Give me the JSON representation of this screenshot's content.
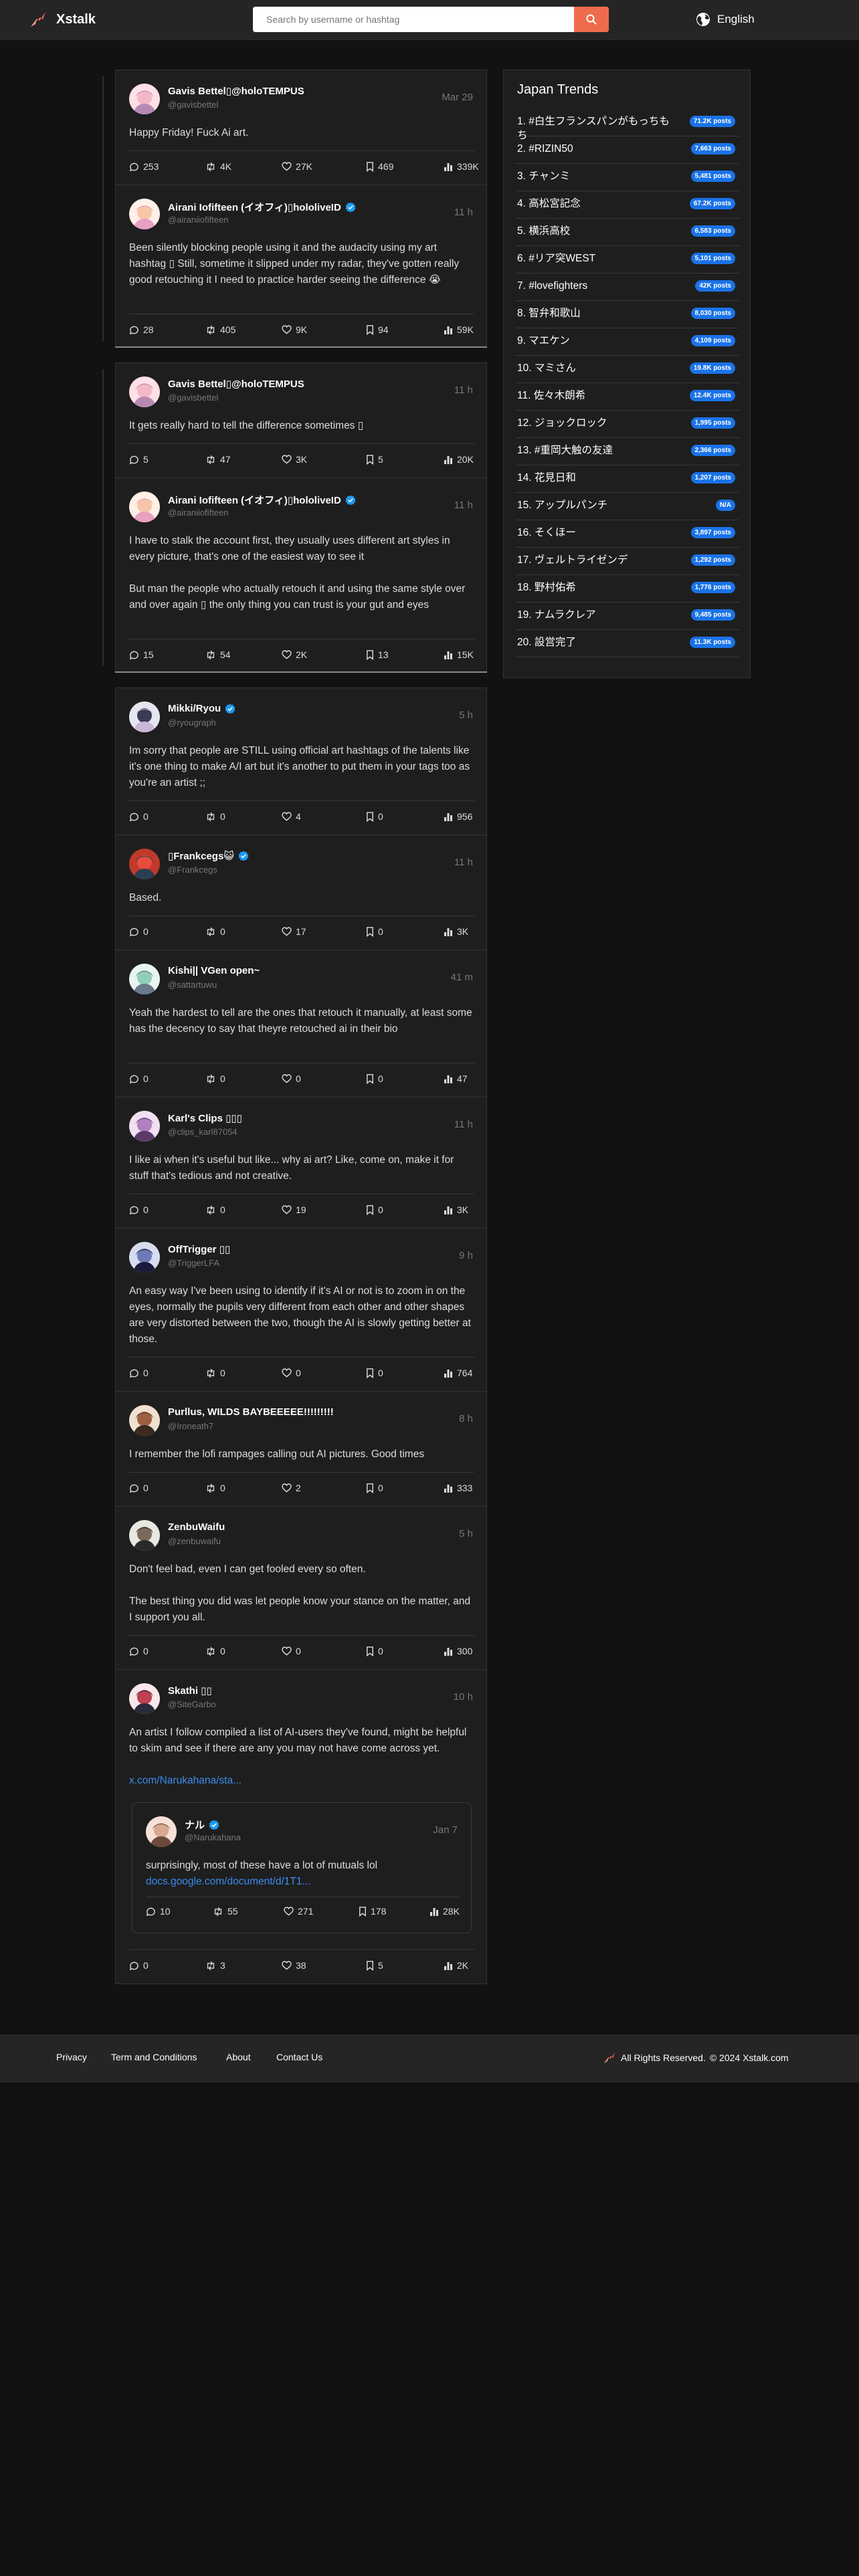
{
  "header": {
    "brand": "Xstalk",
    "search_placeholder": "Search by username or hashtag",
    "language": "English"
  },
  "threads": [
    {
      "posts": [
        {
          "name": "Gavis Bettel▯@holoTEMPUS",
          "handle": "@gavisbettel",
          "time": "Mar 29",
          "text": "Happy Friday! Fuck Ai art.",
          "stats": {
            "replies": "253",
            "reposts": "4K",
            "likes": "27K",
            "bookmarks": "469",
            "views": "339K"
          },
          "avatar": "avatar-gavis"
        },
        {
          "name": "Airani Iofifteen (イオフィ)▯hololiveID",
          "handle": "@airaniiofifteen",
          "time": "11 h",
          "verified": true,
          "text": "Been silently blocking people using it and the audacity using my art hashtag ▯ Still, sometime it slipped under my radar, they've gotten really good retouching it I need to practice harder seeing the difference 😭",
          "stats": {
            "replies": "28",
            "reposts": "405",
            "likes": "9K",
            "bookmarks": "94",
            "views": "59K"
          },
          "avatar": "avatar-iofi"
        }
      ]
    },
    {
      "posts": [
        {
          "name": "Gavis Bettel▯@holoTEMPUS",
          "handle": "@gavisbettel",
          "time": "11 h",
          "text": "It gets really hard to tell the difference sometimes ▯",
          "stats": {
            "replies": "5",
            "reposts": "47",
            "likes": "3K",
            "bookmarks": "5",
            "views": "20K"
          },
          "avatar": "avatar-gavis"
        },
        {
          "name": "Airani Iofifteen (イオフィ)▯hololiveID",
          "handle": "@airaniiofifteen",
          "time": "11 h",
          "verified": true,
          "text": "I have to stalk the account first, they usually uses different art styles in every picture, that's one of the easiest way to see it\n\nBut man the people who actually retouch it and using the same style over and over again ▯ the only thing you can trust is your gut and eyes",
          "stats": {
            "replies": "15",
            "reposts": "54",
            "likes": "2K",
            "bookmarks": "13",
            "views": "15K"
          },
          "avatar": "avatar-iofi"
        }
      ]
    }
  ],
  "replies": [
    {
      "name": "Mikki/Ryou",
      "handle": "@ryougraph",
      "time": "5 h",
      "verified": true,
      "text": "Im sorry that people are STILL using official art hashtags of the talents like it's one thing to make A/I art but it's another to put them in your tags too as you're an artist ;;",
      "stats": {
        "replies": "0",
        "reposts": "0",
        "likes": "4",
        "bookmarks": "0",
        "views": "956"
      },
      "avatar": "avatar-mikki"
    },
    {
      "name": "▯Frankcegs😺",
      "handle": "@Frankcegs",
      "time": "11 h",
      "verified": true,
      "text": "Based.",
      "stats": {
        "replies": "0",
        "reposts": "0",
        "likes": "17",
        "bookmarks": "0",
        "views": "3K"
      },
      "avatar": "avatar-frank"
    },
    {
      "name": "Kishi|| VGen open~",
      "handle": "@sattartuwu",
      "time": "41 m",
      "text": "Yeah the hardest to tell are the ones that retouch it manually, at least some has the decency to say that theyre retouched ai in their bio",
      "stats": {
        "replies": "0",
        "reposts": "0",
        "likes": "0",
        "bookmarks": "0",
        "views": "47"
      },
      "avatar": "avatar-kishi"
    },
    {
      "name": "Karl's Clips ▯▯▯",
      "handle": "@clips_karl87054",
      "time": "11 h",
      "text": "I like ai when it's useful but like... why ai art? Like, come on, make it for stuff that's tedious and not creative.",
      "stats": {
        "replies": "0",
        "reposts": "0",
        "likes": "19",
        "bookmarks": "0",
        "views": "3K"
      },
      "avatar": "avatar-karl"
    },
    {
      "name": "OffTrigger ▯▯",
      "handle": "@TriggerLFA",
      "time": "9 h",
      "text": "An easy way I've been using to identify if it's AI or not is to zoom in on the eyes, normally the pupils very different from each other and other shapes are very distorted between the two, though the AI is slowly getting better at those.",
      "stats": {
        "replies": "0",
        "reposts": "0",
        "likes": "0",
        "bookmarks": "0",
        "views": "764"
      },
      "avatar": "avatar-offtrigger"
    },
    {
      "name": "Purllus, WILDS BAYBEEEEE!!!!!!!!!",
      "handle": "@Ironeath7",
      "time": "8 h",
      "text": "I remember the lofi rampages calling out AI pictures. Good times",
      "stats": {
        "replies": "0",
        "reposts": "0",
        "likes": "2",
        "bookmarks": "0",
        "views": "333"
      },
      "avatar": "avatar-purllus"
    },
    {
      "name": "ZenbuWaifu",
      "handle": "@zenbuwaifu",
      "time": "5 h",
      "text": "Don't feel bad, even I can get fooled every so often.\n\nThe best thing you did was let people know your stance on the matter, and I support you all.",
      "stats": {
        "replies": "0",
        "reposts": "0",
        "likes": "0",
        "bookmarks": "0",
        "views": "300"
      },
      "avatar": "avatar-zenbu"
    },
    {
      "name": "Skathi ▯▯",
      "handle": "@SiteGarbo",
      "time": "10 h",
      "text": "An artist I follow compiled a list of AI-users they've found, might be helpful to skim and see if there are any you may not have come across yet.",
      "link": "x.com/Narukahana/sta...",
      "stats": {
        "replies": "0",
        "reposts": "3",
        "likes": "38",
        "bookmarks": "5",
        "views": "2K"
      },
      "avatar": "avatar-skathi",
      "quote": {
        "name": "ナル",
        "handle": "@Narukahana",
        "time": "Jan 7",
        "verified": true,
        "text": "surprisingly, most of these have a lot of mutuals lol",
        "link": "docs.google.com/document/d/1T1...",
        "stats": {
          "replies": "10",
          "reposts": "55",
          "likes": "271",
          "bookmarks": "178",
          "views": "28K"
        },
        "avatar": "avatar-naru"
      }
    }
  ],
  "trends": {
    "title": "Japan Trends",
    "items": [
      {
        "name": "1. #白生フランスパンがもっちもち",
        "posts": "71.2K posts"
      },
      {
        "name": "2. #RIZIN50",
        "posts": "7,663 posts"
      },
      {
        "name": "3. チャンミ",
        "posts": "5,481 posts"
      },
      {
        "name": "4. 高松宮記念",
        "posts": "67.2K posts"
      },
      {
        "name": "5. 横浜高校",
        "posts": "6,583 posts"
      },
      {
        "name": "6. #リア突WEST",
        "posts": "5,101 posts"
      },
      {
        "name": "7. #lovefighters",
        "posts": "42K posts"
      },
      {
        "name": "8. 智弁和歌山",
        "posts": "8,030 posts"
      },
      {
        "name": "9. マエケン",
        "posts": "4,109 posts"
      },
      {
        "name": "10. マミさん",
        "posts": "19.8K posts"
      },
      {
        "name": "11. 佐々木朗希",
        "posts": "12.4K posts"
      },
      {
        "name": "12. ジョックロック",
        "posts": "1,995 posts"
      },
      {
        "name": "13. #重岡大触の友達",
        "posts": "2,366 posts"
      },
      {
        "name": "14. 花見日和",
        "posts": "1,207 posts"
      },
      {
        "name": "15. アップルパンチ",
        "posts": "N/A"
      },
      {
        "name": "16. そくほー",
        "posts": "3,897 posts"
      },
      {
        "name": "17. ヴェルトライゼンデ",
        "posts": "1,292 posts"
      },
      {
        "name": "18. 野村佑希",
        "posts": "1,776 posts"
      },
      {
        "name": "19. ナムラクレア",
        "posts": "9,485 posts"
      },
      {
        "name": "20. 設営完了",
        "posts": "11.3K posts"
      }
    ]
  },
  "footer": {
    "links": [
      "Privacy",
      "Term and Conditions",
      "About",
      "Contact Us"
    ],
    "copyright": "All Rights Reserved.",
    "copyright_year": "© 2024 Xstalk.com"
  },
  "colors": {
    "accent": "#ee6c4d",
    "badge": "#1a73e8",
    "link": "#3b8df0",
    "verified": "#1d9bf0"
  }
}
